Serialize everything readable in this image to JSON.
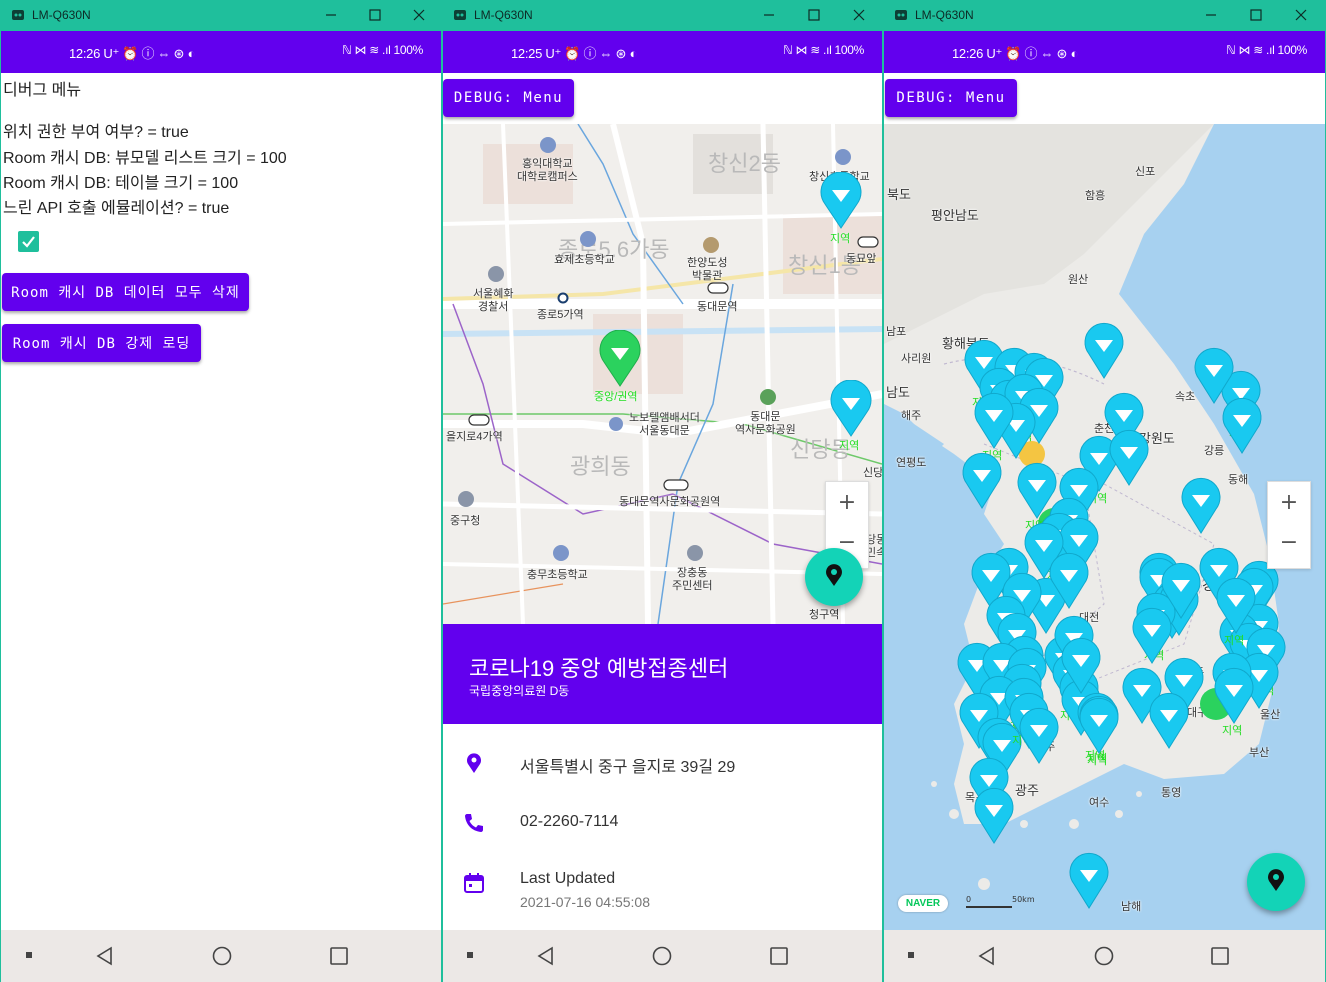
{
  "windows": [
    {
      "title": "LM-Q630N",
      "status_time": "12:26",
      "status_icons_left": "U⁺ ⏰ ⓘ ⇔ ⊛ ◐",
      "status_right": "ℕ ⋈ ≋ .ıl 100%"
    },
    {
      "title": "LM-Q630N",
      "status_time": "12:25",
      "status_icons_left": "U⁺ ⏰ ⓘ ⇔ ⊛ ◐",
      "status_right": "ℕ ⋈ ≋ .ıl 100%"
    },
    {
      "title": "LM-Q630N",
      "status_time": "12:26",
      "status_icons_left": "U⁺ ⏰ ⓘ ⇔ ⊛ ◐",
      "status_right": "ℕ ⋈ ≋ .ıl 100%"
    }
  ],
  "debug_screen": {
    "title": "디버그 메뉴",
    "lines": [
      "위치 권한 부여 여부? = true",
      "Room 캐시 DB: 뷰모델 리스트 크기 = 100",
      "Room 캐시 DB: 테이블 크기 = 100",
      "느린 API 호출 에뮬레이션? = true"
    ],
    "delete_button": "Room 캐시 DB 데이터 모두 삭제",
    "reload_button": "Room 캐시 DB 강제 로딩"
  },
  "map_screen": {
    "debug_button": "DEBUG: Menu",
    "area_labels": [
      "창신2동",
      "종로5.6가동",
      "창신1동",
      "광희동",
      "신당동"
    ],
    "places": [
      {
        "name": "홍익대학교\n대학로캠퍼스"
      },
      {
        "name": "효제초등학교"
      },
      {
        "name": "한양도성\n박물관"
      },
      {
        "name": "창신초등학교"
      },
      {
        "name": "동묘앞"
      },
      {
        "name": "서울혜화\n경찰서"
      },
      {
        "name": "종로5가역"
      },
      {
        "name": "동대문역"
      },
      {
        "name": "을지로4가역"
      },
      {
        "name": "노보텔앰배서더\n서울동대문"
      },
      {
        "name": "동대문\n역사문화공원"
      },
      {
        "name": "동대문역사문화공원역"
      },
      {
        "name": "중구청"
      },
      {
        "name": "충무초등학교"
      },
      {
        "name": "장충동\n주민센터"
      },
      {
        "name": "청구역"
      },
      {
        "name": "신당"
      },
      {
        "name": "당동\n민속"
      }
    ],
    "pins": [
      {
        "label": "지역",
        "color": "#19c9f0"
      },
      {
        "label": "중앙/권역",
        "color": "#2bd25e"
      },
      {
        "label": "지역",
        "color": "#19c9f0"
      }
    ],
    "zoom_in": "+",
    "zoom_out": "−",
    "center": {
      "name": "코로나19 중앙 예방접종센터",
      "facility": "국립중앙의료원 D동",
      "address": "서울특별시 중구 을지로 39길 29",
      "phone": "02-2260-7114",
      "updated_label": "Last Updated",
      "updated_value": "2021-07-16 04:55:08"
    }
  },
  "korea_screen": {
    "debug_button": "DEBUG: Menu",
    "region_labels": [
      "신포",
      "함흥",
      "평안남도",
      "북도",
      "원산",
      "남포",
      "황해북도",
      "사리원",
      "속초",
      "해주",
      "강원도",
      "연평도",
      "춘천",
      "남도",
      "강릉",
      "동해",
      "경상북도",
      "대전",
      "전주",
      "광주",
      "안동",
      "대구",
      "울산",
      "부산",
      "통영",
      "여수",
      "목포",
      "남해"
    ],
    "pin_label_regional": "지역",
    "pin_label_central": "중앙/권역",
    "naver": "NAVER",
    "scale_zero": "0",
    "scale_text": "50km",
    "zoom_in": "+",
    "zoom_out": "−"
  }
}
